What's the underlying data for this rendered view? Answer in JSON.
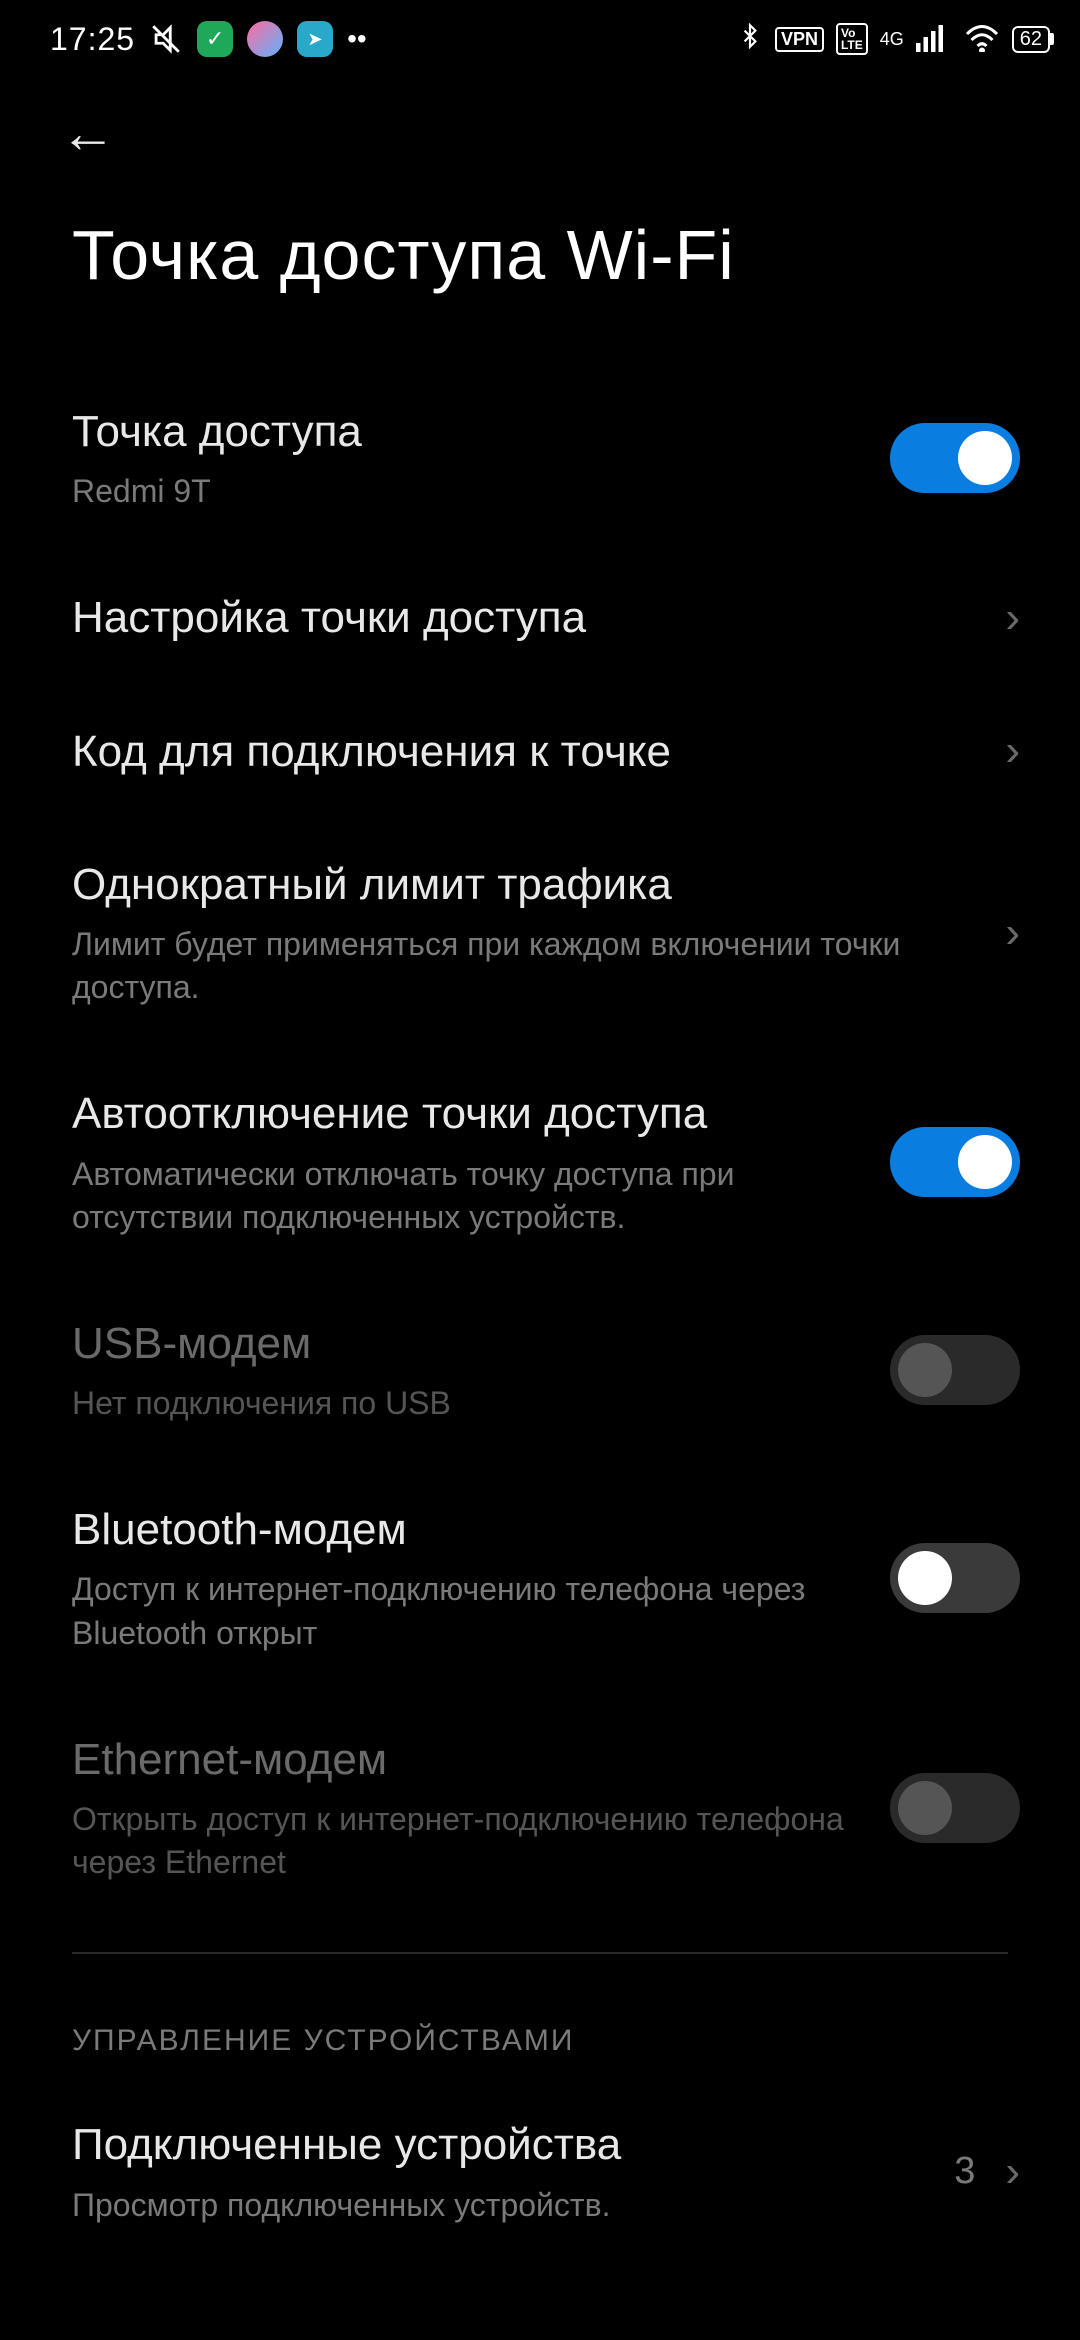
{
  "status": {
    "time": "17:25",
    "battery": "62"
  },
  "page": {
    "title": "Точка доступа Wi-Fi"
  },
  "items": [
    {
      "title": "Точка доступа",
      "subtitle": "Redmi 9T"
    },
    {
      "title": "Настройка точки доступа"
    },
    {
      "title": "Код для подключения к точке"
    },
    {
      "title": "Однократный лимит трафика",
      "subtitle": "Лимит будет применяться при каждом включении точки доступа."
    },
    {
      "title": "Автоотключение точки доступа",
      "subtitle": "Автоматически отключать точку доступа при отсутствии подключенных устройств."
    },
    {
      "title": "USB-модем",
      "subtitle": "Нет подключения по USB"
    },
    {
      "title": "Bluetooth-модем",
      "subtitle": "Доступ к интернет-подключению телефона через Bluetooth открыт"
    },
    {
      "title": "Ethernet-модем",
      "subtitle": "Открыть доступ к интернет-подключению телефона через Ethernet"
    }
  ],
  "section": {
    "header": "УПРАВЛЕНИЕ УСТРОЙСТВАМИ"
  },
  "connected": {
    "title": "Подключенные устройства",
    "subtitle": "Просмотр подключенных устройств.",
    "count": "3"
  }
}
